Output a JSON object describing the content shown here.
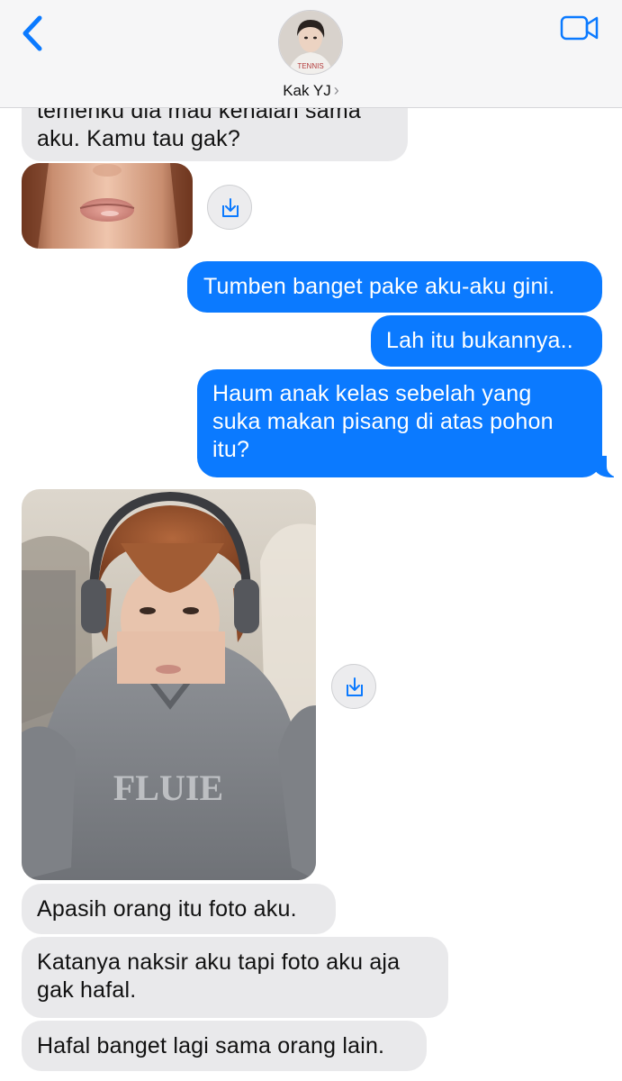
{
  "header": {
    "contact_name": "Kak YJ",
    "chevron": "›",
    "back_icon": "chevron-left-icon",
    "video_icon": "video-camera-icon",
    "accent": "#0b7aff"
  },
  "messages": [
    {
      "from": "them",
      "text": "temenku dia mau kenalan sama\naku. Kamu tau gak?"
    },
    {
      "from": "them",
      "type": "photo",
      "description_icon": "save-icon"
    },
    {
      "from": "me",
      "text": "Tumben banget pake aku-aku gini."
    },
    {
      "from": "me",
      "text": "Lah itu bukannya.."
    },
    {
      "from": "me",
      "text": "Haum anak kelas sebelah yang\nsuka makan pisang di atas pohon\nitu?"
    },
    {
      "from": "them",
      "type": "photo",
      "description_icon": "save-icon"
    },
    {
      "from": "them",
      "text": "Apasih orang itu foto aku."
    },
    {
      "from": "them",
      "text": "Katanya naksir aku tapi foto aku aja\ngak hafal."
    },
    {
      "from": "them",
      "text": "Hafal banget lagi sama orang lain."
    }
  ],
  "colors": {
    "incoming_bubble": "#e9e9eb",
    "outgoing_bubble": "#0b7aff",
    "header_bg": "#f6f6f7"
  }
}
